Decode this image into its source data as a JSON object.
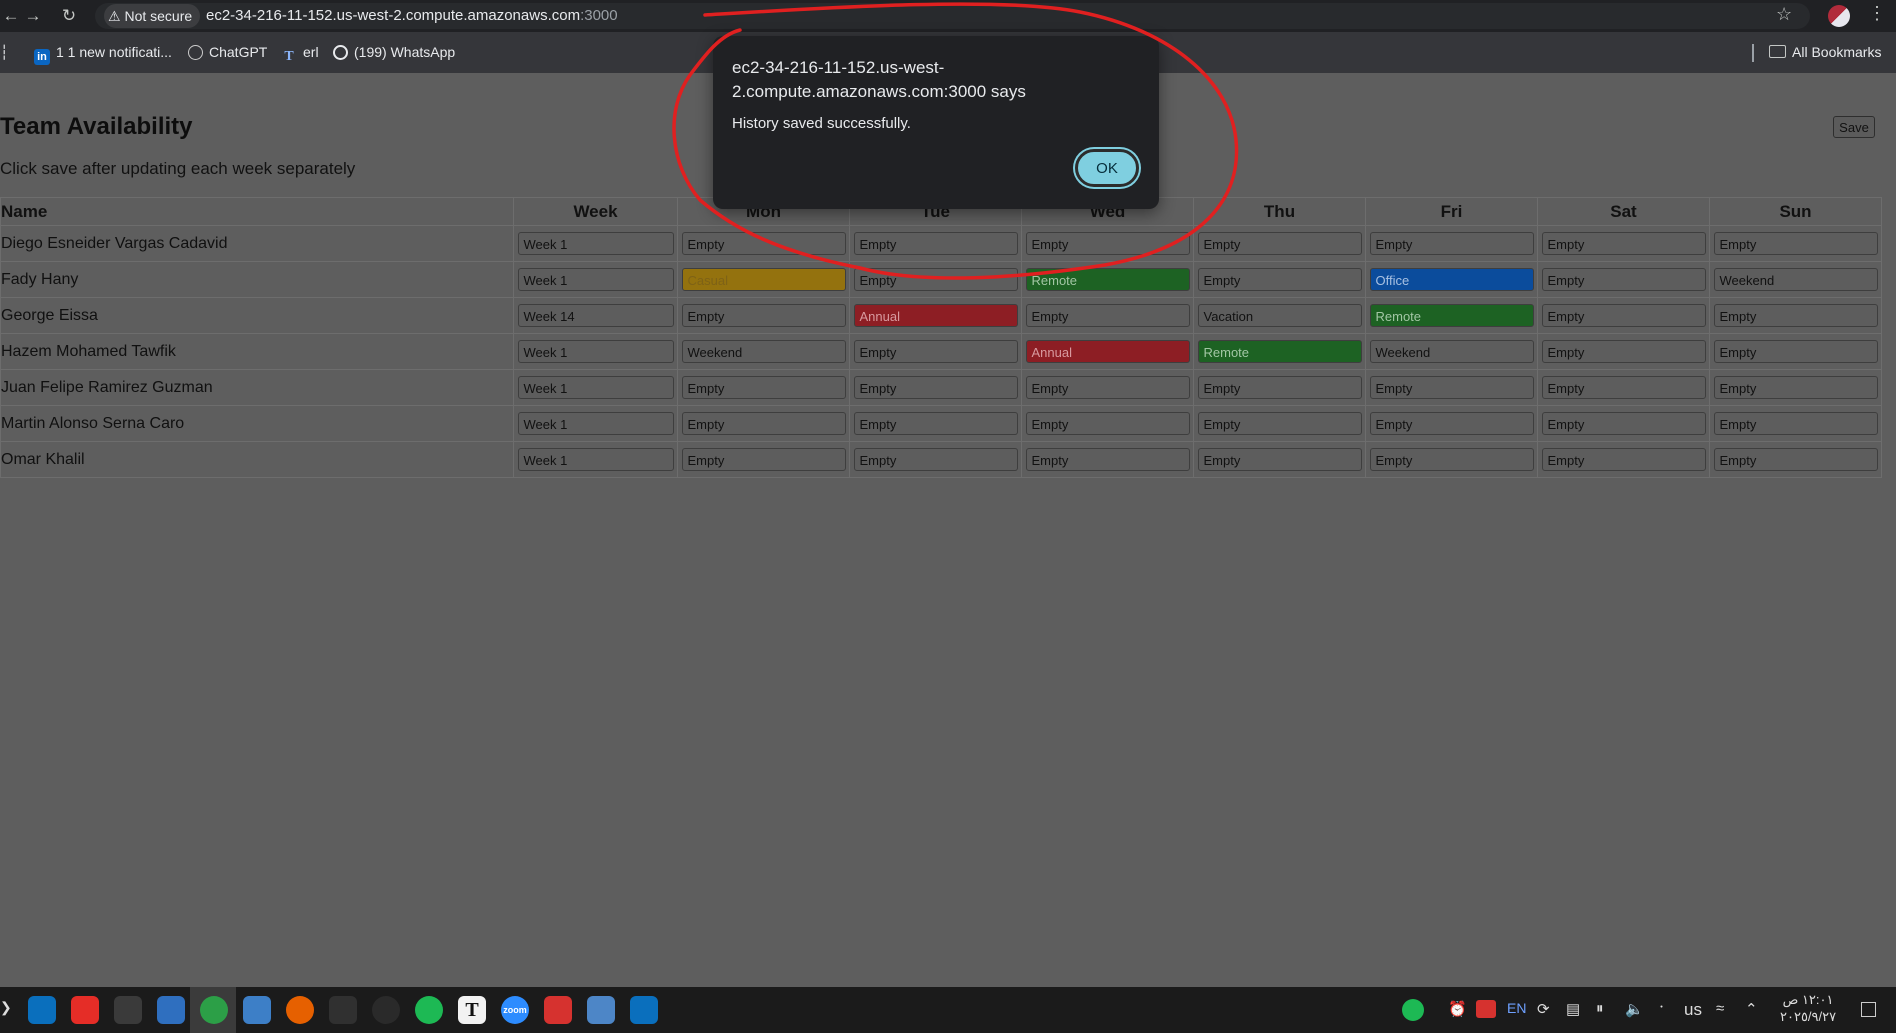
{
  "browser": {
    "security_label": "Not secure",
    "url_host": "ec2-34-216-11-152.us-west-2.compute.amazonaws.com",
    "url_port": ":3000",
    "bookmarks": [
      {
        "label": "1 1 new notificati...",
        "icon": "linkedin-icon"
      },
      {
        "label": "ChatGPT",
        "icon": "chatgpt-icon"
      },
      {
        "label": "erl",
        "icon": "text-t-icon"
      },
      {
        "label": "(199) WhatsApp",
        "icon": "whatsapp-icon"
      }
    ],
    "all_bookmarks_label": "All Bookmarks"
  },
  "page": {
    "title": "Team Availability",
    "subtitle": "Click save after updating each week separately",
    "save_label": "Save"
  },
  "table": {
    "headers": [
      "Name",
      "Week",
      "Mon",
      "Tue",
      "Wed",
      "Thu",
      "Fri",
      "Sat",
      "Sun"
    ],
    "rows": [
      {
        "name": "Diego Esneider Vargas Cadavid",
        "week": "Week 1",
        "days": [
          "Empty",
          "Empty",
          "Empty",
          "Empty",
          "Empty",
          "Empty",
          "Empty"
        ]
      },
      {
        "name": "Fady Hany",
        "week": "Week 1",
        "days": [
          "Casual",
          "Empty",
          "Remote",
          "Empty",
          "Office",
          "Empty",
          "Weekend"
        ]
      },
      {
        "name": "George Eissa",
        "week": "Week 14",
        "days": [
          "Empty",
          "Annual",
          "Empty",
          "Vacation",
          "Remote",
          "Empty",
          "Empty"
        ]
      },
      {
        "name": "Hazem Mohamed Tawfik",
        "week": "Week 1",
        "days": [
          "Weekend",
          "Empty",
          "Annual",
          "Remote",
          "Weekend",
          "Empty",
          "Empty"
        ]
      },
      {
        "name": "Juan Felipe Ramirez Guzman",
        "week": "Week 1",
        "days": [
          "Empty",
          "Empty",
          "Empty",
          "Empty",
          "Empty",
          "Empty",
          "Empty"
        ]
      },
      {
        "name": "Martin Alonso Serna Caro",
        "week": "Week 1",
        "days": [
          "Empty",
          "Empty",
          "Empty",
          "Empty",
          "Empty",
          "Empty",
          "Empty"
        ]
      },
      {
        "name": "Omar Khalil",
        "week": "Week 1",
        "days": [
          "Empty",
          "Empty",
          "Empty",
          "Empty",
          "Empty",
          "Empty",
          "Empty"
        ]
      }
    ],
    "status_colors": {
      "Casual": "#94720e",
      "Remote": "#1d6223",
      "Office": "#0b4c9c",
      "Annual": "#8d1e24"
    }
  },
  "dialog": {
    "title": "ec2-34-216-11-152.us-west-2.compute.amazonaws.com:3000 says",
    "message": "History saved successfully.",
    "ok_label": "OK"
  },
  "annotation": {
    "color": "#e02020"
  },
  "taskbar": {
    "apps": [
      {
        "icon": "vscode-icon",
        "color": "#0a6fbd",
        "label": ""
      },
      {
        "icon": "youtube-icon",
        "color": "#e52d27",
        "label": ""
      },
      {
        "icon": "settings-sliders-icon",
        "color": "#3a3a3a",
        "label": ""
      },
      {
        "icon": "software-store-icon",
        "color": "#2f6fbf",
        "label": ""
      },
      {
        "icon": "chrome-icon",
        "color": "#2c9f47",
        "label": "",
        "active": true
      },
      {
        "icon": "files-icon",
        "color": "#3d7fc7",
        "label": ""
      },
      {
        "icon": "firefox-icon",
        "color": "#e66000",
        "label": ""
      },
      {
        "icon": "terminal-icon",
        "color": "#303030",
        "label": ""
      },
      {
        "icon": "obs-icon",
        "color": "#2a2a2a",
        "label": ""
      },
      {
        "icon": "spotify-icon",
        "color": "#1db954",
        "label": ""
      },
      {
        "icon": "typora-icon",
        "color": "#f2f2f2",
        "label": "T"
      },
      {
        "icon": "zoom-icon",
        "color": "#2d8cff",
        "label": "zoom"
      },
      {
        "icon": "anydesk-icon",
        "color": "#d6322f",
        "label": ""
      },
      {
        "icon": "image-viewer-icon",
        "color": "#4d86c7",
        "label": ""
      },
      {
        "icon": "vscode-icon",
        "color": "#0a6fbd",
        "label": ""
      }
    ],
    "tray": {
      "lang": "EN",
      "layout": "us",
      "time": "١٢:٠١ ص",
      "date": "٢٠٢٥/٩/٢٧"
    }
  }
}
